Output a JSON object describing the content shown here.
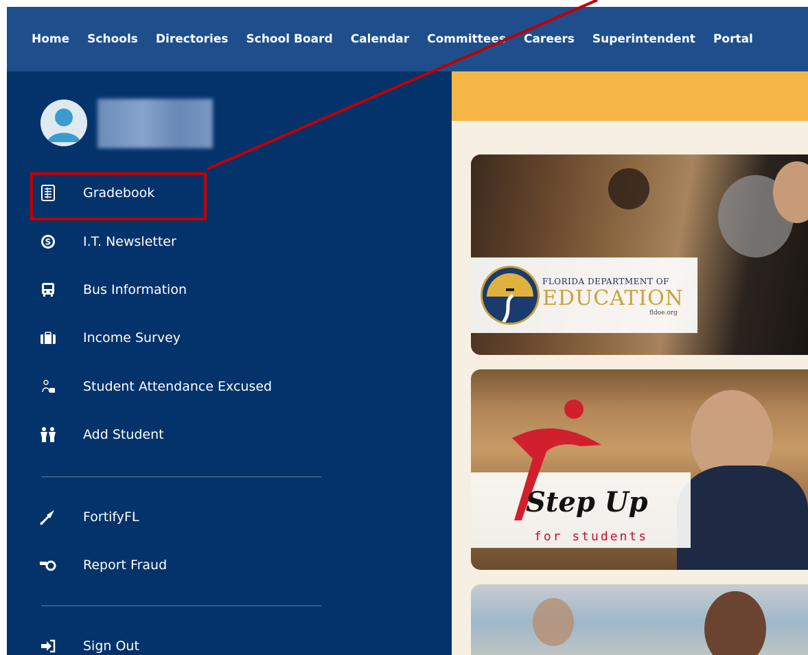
{
  "topnav": {
    "items": [
      "Home",
      "Schools",
      "Directories",
      "School Board",
      "Calendar",
      "Committees",
      "Careers",
      "Superintendent",
      "Portal"
    ]
  },
  "sidebar": {
    "items": [
      {
        "label": "Gradebook",
        "icon": "gradebook-icon"
      },
      {
        "label": "I.T. Newsletter",
        "icon": "newsletter-icon"
      },
      {
        "label": "Bus Information",
        "icon": "bus-icon"
      },
      {
        "label": "Income Survey",
        "icon": "briefcase-icon"
      },
      {
        "label": "Student Attendance Excused",
        "icon": "attendance-icon"
      },
      {
        "label": "Add Student",
        "icon": "add-student-icon"
      },
      {
        "label": "FortifyFL",
        "icon": "megaphone-icon"
      },
      {
        "label": "Report Fraud",
        "icon": "whistle-icon"
      },
      {
        "label": "Sign Out",
        "icon": "sign-out-icon"
      }
    ]
  },
  "cards": {
    "fldoe": {
      "title_line1": "FLORIDA DEPARTMENT OF",
      "title_line2": "EDUCATION",
      "url": "fldoe.org"
    },
    "stepup": {
      "script": "Step Up",
      "sub": "for students"
    }
  },
  "colors": {
    "topnav": "#1e4f8c",
    "sidebar": "#04336b",
    "banner": "#f5b547",
    "main_bg": "#f8efe3",
    "highlight": "#c00000"
  }
}
